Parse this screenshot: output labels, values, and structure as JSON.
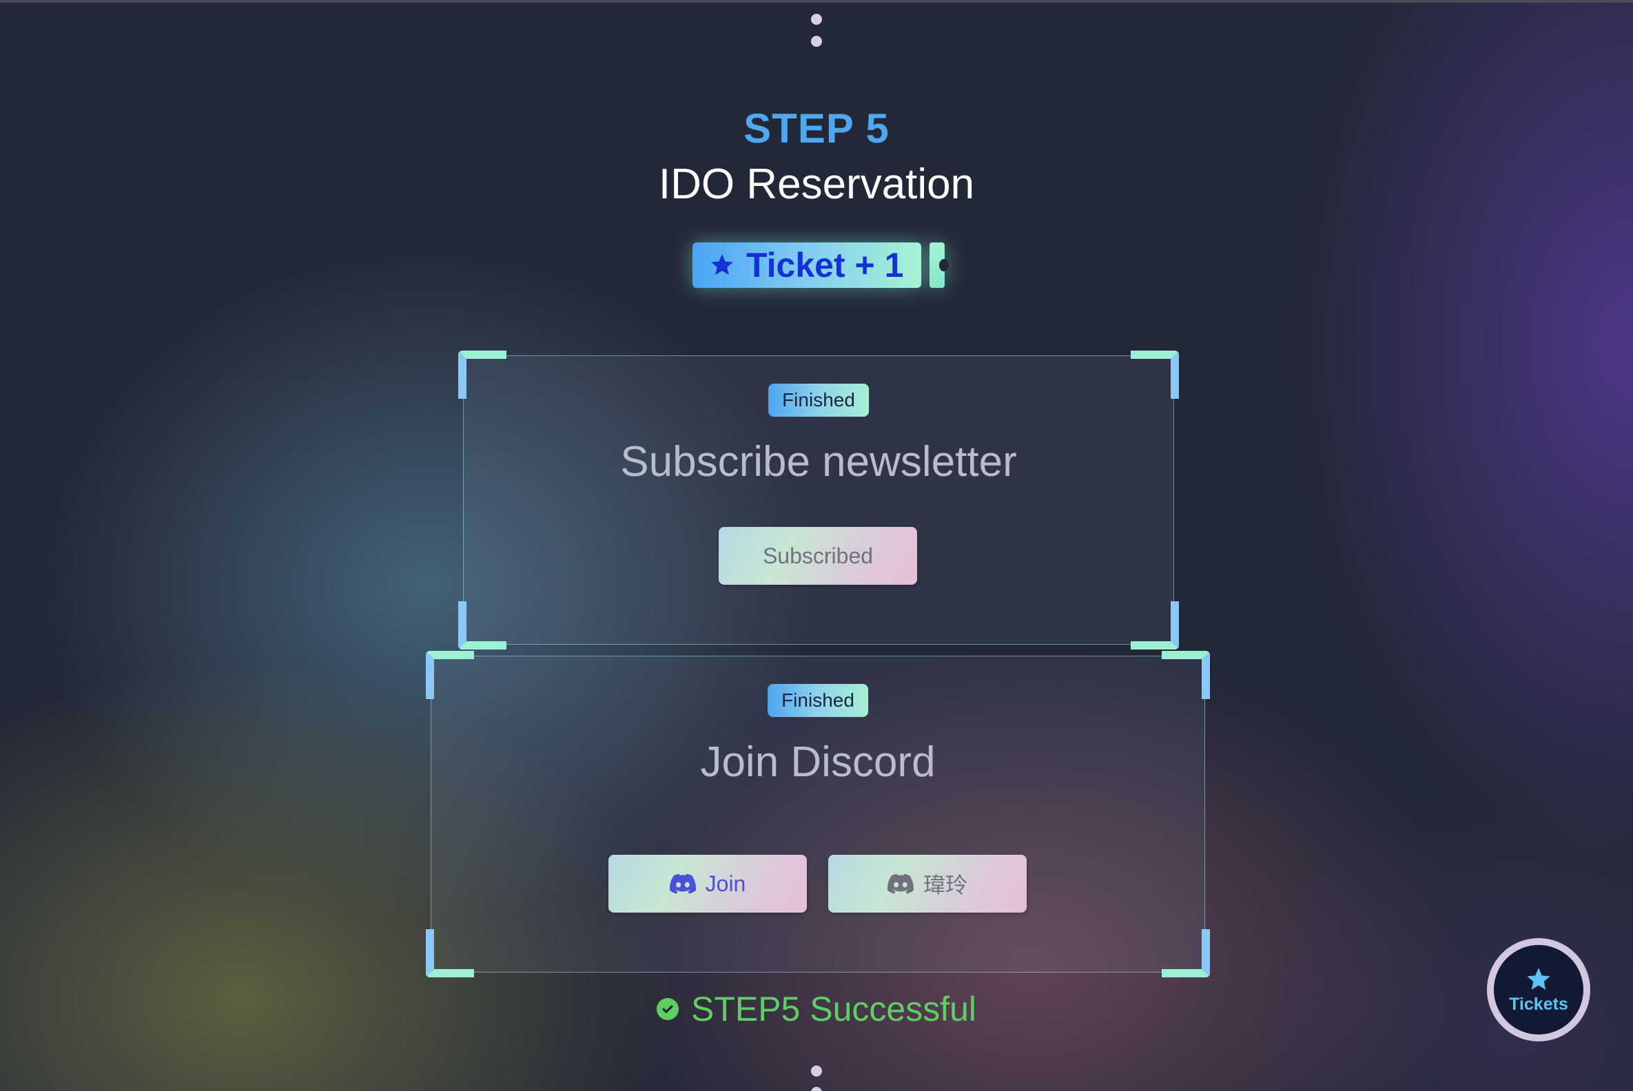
{
  "step": {
    "number_label": "STEP 5",
    "title": "IDO Reservation",
    "ticket_label": "Ticket + 1"
  },
  "tasks": [
    {
      "status": "Finished",
      "title": "Subscribe newsletter",
      "buttons": [
        "Subscribed"
      ]
    },
    {
      "status": "Finished",
      "title": "Join Discord",
      "buttons": [
        "Join",
        "瑋玲"
      ]
    }
  ],
  "result": {
    "message": "STEP5 Successful"
  },
  "fab": {
    "label": "Tickets"
  },
  "icons": {
    "ticket": "star-icon",
    "discord": "discord-icon",
    "success": "check-circle-icon",
    "fab": "star-icon"
  },
  "colors": {
    "step_accent": "#4fa8ee",
    "ticket_text": "#1530d6",
    "success": "#5ed062",
    "discord_primary": "#4b50d8"
  }
}
